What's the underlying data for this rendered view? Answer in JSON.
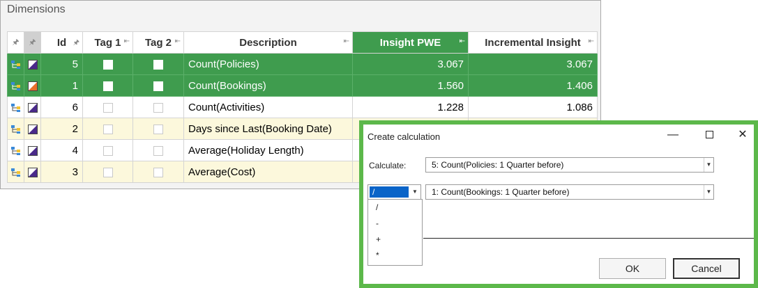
{
  "panel": {
    "title": "Dimensions",
    "columns": {
      "id": "Id",
      "tag1": "Tag 1",
      "tag2": "Tag 2",
      "description": "Description",
      "insight_pwe": "Insight PWE",
      "incremental": "Incremental Insight"
    },
    "rows": [
      {
        "id": "5",
        "description": "Count(Policies)",
        "pwe": "3.067",
        "inc": "3.067",
        "state": "selected"
      },
      {
        "id": "1",
        "description": "Count(Bookings)",
        "pwe": "1.560",
        "inc": "1.406",
        "state": "selected"
      },
      {
        "id": "6",
        "description": "Count(Activities)",
        "pwe": "1.228",
        "inc": "1.086",
        "state": "normal"
      },
      {
        "id": "2",
        "description": "Days since Last(Booking Date)",
        "pwe": "",
        "inc": "",
        "state": "alt"
      },
      {
        "id": "4",
        "description": "Average(Holiday Length)",
        "pwe": "",
        "inc": "",
        "state": "normal"
      },
      {
        "id": "3",
        "description": "Average(Cost)",
        "pwe": "",
        "inc": "",
        "state": "alt"
      }
    ],
    "colors": {
      "selected": "#3f9c4e",
      "alt": "#fcf8dc"
    }
  },
  "dialog": {
    "title": "Create calculation",
    "calculate_label": "Calculate:",
    "operand1": "5: Count(Policies: 1 Quarter before)",
    "operator": "/",
    "operand2": "1: Count(Bookings: 1 Quarter before)",
    "operator_options": [
      "/",
      "-",
      "+",
      "*"
    ],
    "ok_label": "OK",
    "cancel_label": "Cancel",
    "frame_color": "#5cb84a"
  }
}
